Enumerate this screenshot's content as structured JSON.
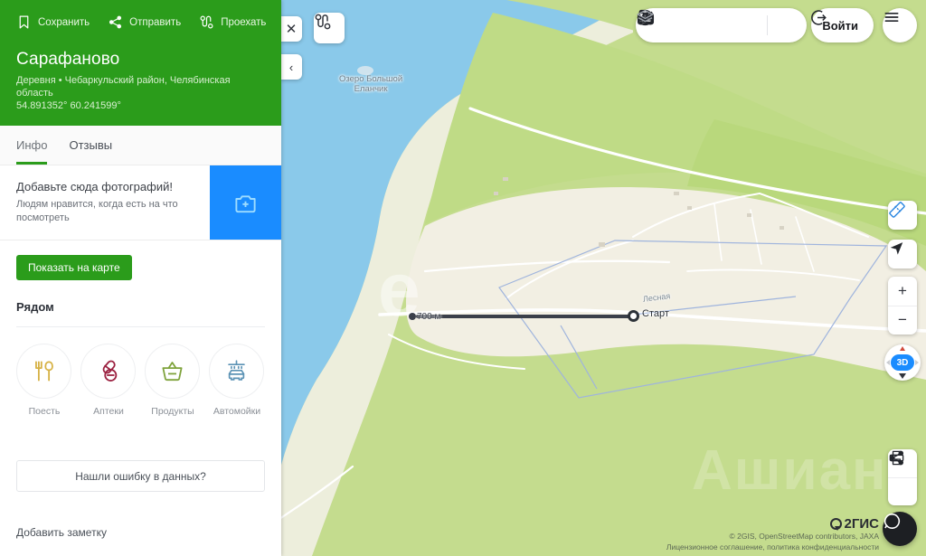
{
  "sidebar": {
    "header": {
      "actions": [
        {
          "icon": "bookmark-icon",
          "label": "Сохранить"
        },
        {
          "icon": "share-icon",
          "label": "Отправить"
        },
        {
          "icon": "route-icon",
          "label": "Проехать"
        }
      ],
      "title": "Сарафаново",
      "subtitle": "Деревня • Чебаркульский район, Челябинская область",
      "coords": "54.891352° 60.241599°",
      "bg_color": "#2b9c1b"
    },
    "tabs": [
      {
        "label": "Инфо",
        "active": true
      },
      {
        "label": "Отзывы",
        "active": false
      }
    ],
    "photo_promo": {
      "title": "Добавьте сюда фотографий!",
      "text": "Людям нравится, когда есть на что посмотреть",
      "button_icon": "add-photo-icon",
      "button_color": "#1a8cff"
    },
    "show_on_map_label": "Показать на карте",
    "nearby": {
      "title": "Рядом",
      "items": [
        {
          "label": "Поесть",
          "icon": "cutlery-icon",
          "color": "#d6b143"
        },
        {
          "label": "Аптеки",
          "icon": "pills-icon",
          "color": "#9c2342"
        },
        {
          "label": "Продукты",
          "icon": "basket-icon",
          "color": "#7fa33c"
        },
        {
          "label": "Автомойки",
          "icon": "carwash-icon",
          "color": "#5c93b5"
        }
      ]
    },
    "report_error_label": "Нашли ошибку в данных?",
    "add_note_label": "Добавить заметку"
  },
  "map": {
    "close_label": "✕",
    "collapse_label": "‹",
    "route_button_icon": "route-icon",
    "top_tools": [
      {
        "icon": "parking-person-icon",
        "name": "poi-icon"
      },
      {
        "icon": "transport-icon",
        "name": "transport-icon"
      },
      {
        "icon": "ruble-icon",
        "name": "prices-icon"
      },
      {
        "icon": "traffic-crown-icon",
        "name": "traffic-icon"
      },
      {
        "icon": "layers-icon",
        "name": "layers-icon"
      }
    ],
    "login_label": "Войти",
    "menu_icon": "hamburger-icon",
    "ruler_icon": "ruler-icon",
    "locate_icon": "locate-arrow-icon",
    "zoom_in_label": "+",
    "zoom_out_label": "−",
    "compass_label": "3D",
    "share_icon": "share-icon",
    "print_icon": "print-icon",
    "chat_icon": "chat-bubble-icon",
    "labels": {
      "lake": "Озеро Большой\nЕланчик",
      "street": "Лесная",
      "start": "Старт",
      "distance": "700 м"
    },
    "watermark_e": "e",
    "watermark_big": "Ашиан",
    "attribution": {
      "brand": "2ГИС",
      "line1": "© 2GIS, OpenStreetMap contributors, JAXA",
      "line2": "Лицензионное соглашение, политика конфиденциальности"
    },
    "colors": {
      "water": "#8ac9ea",
      "land": "#c4dc8e",
      "sand": "#f3f0e2",
      "road": "#ffffff"
    }
  }
}
